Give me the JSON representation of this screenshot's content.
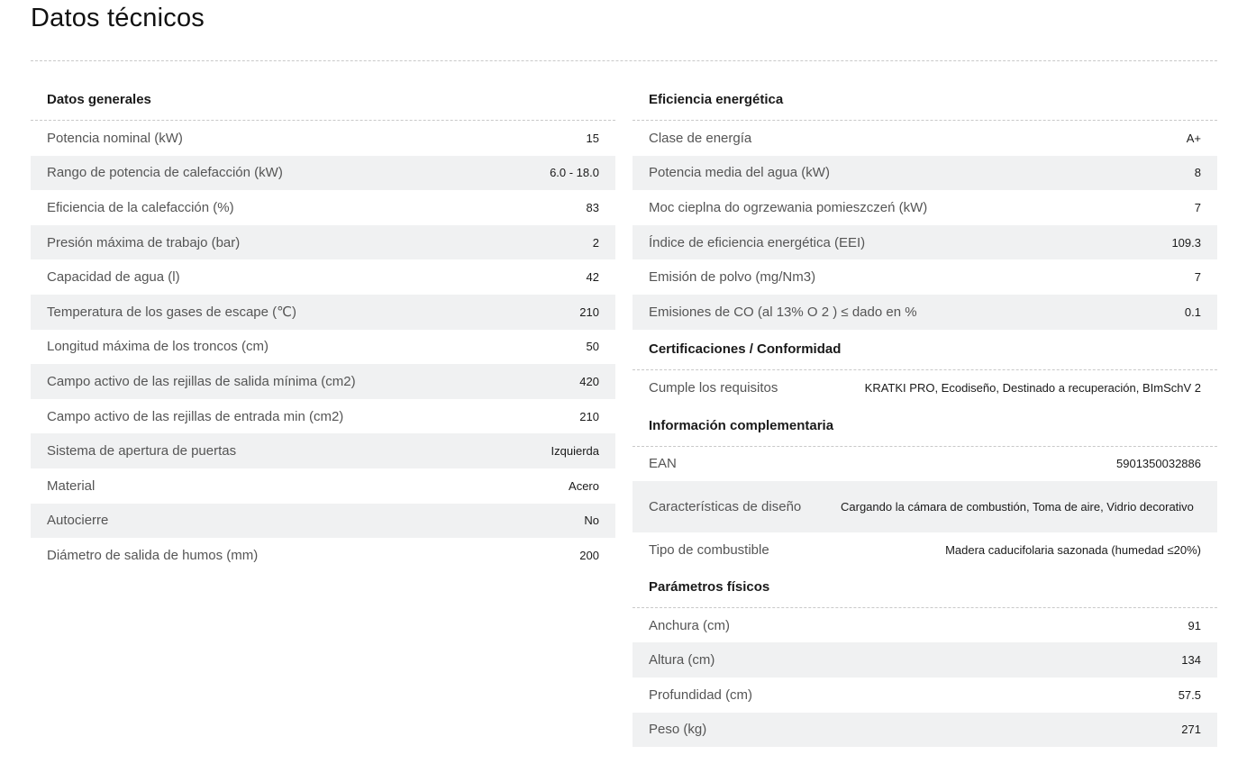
{
  "page_title": "Datos técnicos",
  "sections_left": [
    {
      "title": "Datos generales",
      "rows": [
        {
          "label": "Potencia nominal (kW)",
          "value": "15"
        },
        {
          "label": "Rango de potencia de calefacción (kW)",
          "value": "6.0 - 18.0"
        },
        {
          "label": "Eficiencia de la calefacción (%)",
          "value": "83"
        },
        {
          "label": "Presión máxima de trabajo (bar)",
          "value": "2"
        },
        {
          "label": "Capacidad de agua (l)",
          "value": "42"
        },
        {
          "label": "Temperatura de los gases de escape (℃)",
          "value": "210"
        },
        {
          "label": "Longitud máxima de los troncos (cm)",
          "value": "50"
        },
        {
          "label": "Campo activo de las rejillas de salida mínima (cm2)",
          "value": "420"
        },
        {
          "label": "Campo activo de las rejillas de entrada min (cm2)",
          "value": "210"
        },
        {
          "label": "Sistema de apertura de puertas",
          "value": "Izquierda"
        },
        {
          "label": "Material",
          "value": "Acero"
        },
        {
          "label": "Autocierre",
          "value": "No"
        },
        {
          "label": "Diámetro de salida de humos (mm)",
          "value": "200"
        }
      ]
    }
  ],
  "sections_right": [
    {
      "title": "Eficiencia energética",
      "rows": [
        {
          "label": "Clase de energía",
          "value": "A+"
        },
        {
          "label": "Potencia media del agua (kW)",
          "value": "8"
        },
        {
          "label": "Moc cieplna do ogrzewania pomieszczeń (kW)",
          "value": "7"
        },
        {
          "label": "Índice de eficiencia energética (EEI)",
          "value": "109.3"
        },
        {
          "label": "Emisión de polvo (mg/Nm3)",
          "value": "7"
        },
        {
          "label": "Emisiones de CO (al 13% O 2 ) ≤ dado en %",
          "value": "0.1"
        }
      ]
    },
    {
      "title": "Certificaciones / Conformidad",
      "rows": [
        {
          "label": "Cumple los requisitos",
          "value": "KRATKI PRO, Ecodiseño, Destinado a recuperación, BImSchV 2"
        }
      ]
    },
    {
      "title": "Información complementaria",
      "rows": [
        {
          "label": "EAN",
          "value": "5901350032886"
        },
        {
          "label": "Características de diseño",
          "value": "Cargando la cámara de combustión, Toma de aire, Vidrio decorativo"
        },
        {
          "label": "Tipo de combustible",
          "value": "Madera caducifolaria sazonada (humedad ≤20%)"
        }
      ]
    },
    {
      "title": "Parámetros físicos",
      "rows": [
        {
          "label": "Anchura (cm)",
          "value": "91"
        },
        {
          "label": "Altura (cm)",
          "value": "134"
        },
        {
          "label": "Profundidad (cm)",
          "value": "57.5"
        },
        {
          "label": "Peso (kg)",
          "value": "271"
        }
      ]
    }
  ]
}
